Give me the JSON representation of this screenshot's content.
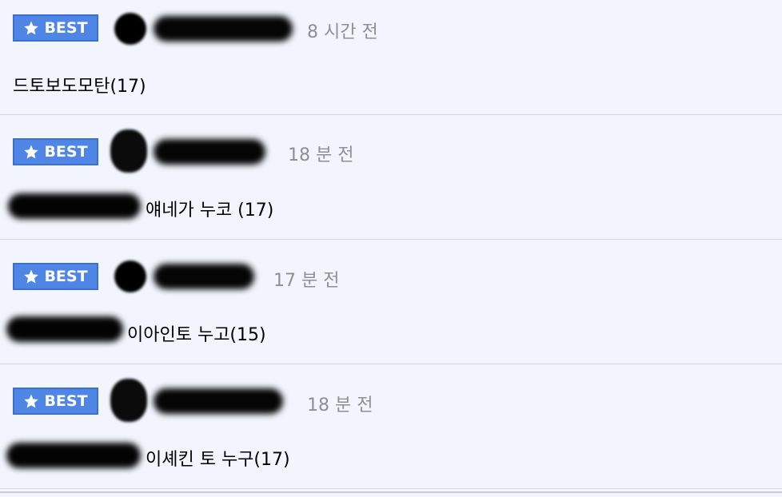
{
  "badge_label": "BEST",
  "badge_icon": "star-icon",
  "colors": {
    "background": "#f2f5fd",
    "badge": "#4f86e6",
    "time": "#8e8f93",
    "divider": "#d4d6db"
  },
  "comments": [
    {
      "time": "8 시간 전",
      "text": "드토보도모탄(17)"
    },
    {
      "time": "18 분 전",
      "text": "얘네가 누코 (17)"
    },
    {
      "time": "17 분 전",
      "text": "이아인토 누고(15)"
    },
    {
      "time": "18 분 전",
      "text": "이셰킨 토 누구(17)"
    }
  ]
}
